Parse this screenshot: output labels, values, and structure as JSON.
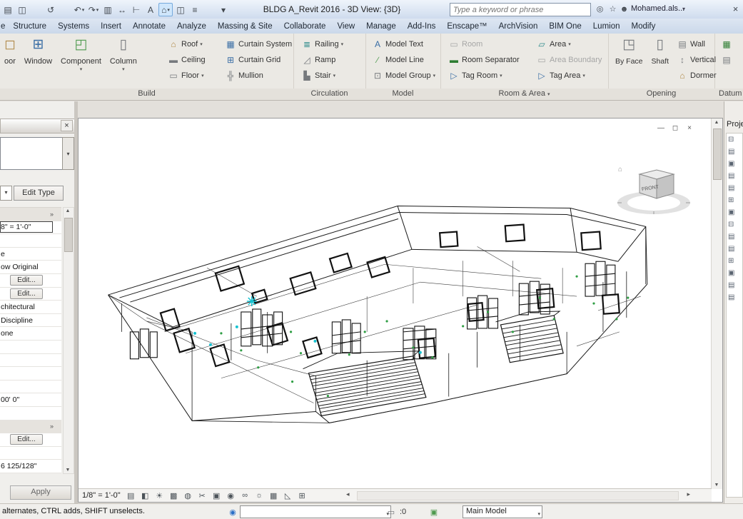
{
  "colors": {
    "titlebar_blue": "#d6e2f2",
    "ribbon_bg": "#ebe9e4",
    "canvas_bg": "#ffffff",
    "selection_cyan": "#17c3d2",
    "marker_green": "#2f9e44",
    "disabled_gray": "#a6a6a6"
  },
  "titlebar": {
    "title": "BLDG A_Revit 2016 - 3D View: {3D}",
    "search_placeholder": "Type a keyword or phrase",
    "username": "Mohamed.als...",
    "qat": [
      {
        "name": "open-icon",
        "glyph": "▤"
      },
      {
        "name": "save-icon",
        "glyph": "◫"
      },
      {
        "name": "qat-separator",
        "glyph": "",
        "sep": true
      },
      {
        "name": "sync-icon",
        "glyph": "↺"
      },
      {
        "name": "qat-separator",
        "glyph": "",
        "sep": true
      },
      {
        "name": "undo-icon",
        "glyph": "↶",
        "dd": true
      },
      {
        "name": "redo-icon",
        "glyph": "↷",
        "dd": true
      },
      {
        "name": "print-icon",
        "glyph": "▥"
      },
      {
        "name": "measure-icon",
        "glyph": "↔"
      },
      {
        "name": "aligned-dimension-icon",
        "glyph": "⊢"
      },
      {
        "name": "text-icon",
        "glyph": "A"
      },
      {
        "name": "default-3d-view-icon",
        "glyph": "⌂",
        "active": true,
        "dd": true
      },
      {
        "name": "section-icon",
        "glyph": "◫"
      },
      {
        "name": "thin-lines-icon",
        "glyph": "≡"
      },
      {
        "name": "qat-separator",
        "glyph": "",
        "sep": true
      },
      {
        "name": "qat-customize-icon",
        "glyph": "▾"
      }
    ],
    "search_go_glyph": "◎",
    "star_glyph": "☆",
    "signin_glyph": "☻",
    "exchange_glyph": "×",
    "user_dd_glyph": "▾"
  },
  "tabs": [
    "e",
    "Structure",
    "Systems",
    "Insert",
    "Annotate",
    "Analyze",
    "Massing & Site",
    "Collaborate",
    "View",
    "Manage",
    "Add-Ins",
    "Enscape™",
    "ArchVision",
    "BIM One",
    "Lumion",
    "Modify"
  ],
  "ribbon": {
    "build": {
      "title": "Build",
      "big": [
        {
          "name": "door-button",
          "icon_name": "door-icon",
          "icon_class": "c-tan",
          "glyph": "◻",
          "label": "oor"
        },
        {
          "name": "window-button",
          "icon_name": "window-icon",
          "icon_class": "c-blue",
          "glyph": "⊞",
          "label": "Window"
        },
        {
          "name": "component-button",
          "icon_name": "component-icon",
          "icon_class": "c-green",
          "glyph": "◰",
          "label": "Component",
          "dropdown": true
        },
        {
          "name": "column-button",
          "icon_name": "column-icon",
          "icon_class": "c-gray",
          "glyph": "▯",
          "label": "Column",
          "dropdown": true
        }
      ],
      "col1": [
        {
          "name": "roof-button",
          "icon_name": "roof-icon",
          "icon_class": "c-tan",
          "glyph": "⌂",
          "label": "Roof",
          "dropdown": true
        },
        {
          "name": "ceiling-button",
          "icon_name": "ceiling-icon",
          "icon_class": "c-gray",
          "glyph": "▬",
          "label": "Ceiling"
        },
        {
          "name": "floor-button",
          "icon_name": "floor-icon",
          "icon_class": "c-gray",
          "glyph": "▭",
          "label": "Floor",
          "dropdown": true
        }
      ],
      "col2": [
        {
          "name": "curtain-system-button",
          "icon_name": "curtain-system-icon",
          "icon_class": "c-blue",
          "glyph": "▦",
          "label": "Curtain System"
        },
        {
          "name": "curtain-grid-button",
          "icon_name": "curtain-grid-icon",
          "icon_class": "c-blue",
          "glyph": "⊞",
          "label": "Curtain Grid"
        },
        {
          "name": "mullion-button",
          "icon_name": "mullion-icon",
          "icon_class": "c-gray",
          "glyph": "╬",
          "label": "Mullion"
        }
      ]
    },
    "circulation": {
      "title": "Circulation",
      "col1": [
        {
          "name": "railing-button",
          "icon_name": "railing-icon",
          "icon_class": "c-teal",
          "glyph": "≣",
          "label": "Railing",
          "dropdown": true
        },
        {
          "name": "ramp-button",
          "icon_name": "ramp-icon",
          "icon_class": "c-gray",
          "glyph": "◿",
          "label": "Ramp"
        },
        {
          "name": "stair-button",
          "icon_name": "stair-icon",
          "icon_class": "c-gray",
          "glyph": "▙",
          "label": "Stair",
          "dropdown": true
        }
      ]
    },
    "model": {
      "title": "Model",
      "col1": [
        {
          "name": "model-text-button",
          "icon_name": "model-text-icon",
          "icon_class": "c-blue",
          "glyph": "A",
          "label": "Model Text"
        },
        {
          "name": "model-line-button",
          "icon_name": "model-line-icon",
          "icon_class": "c-green",
          "glyph": "∕",
          "label": "Model Line"
        },
        {
          "name": "model-group-button",
          "icon_name": "model-group-icon",
          "icon_class": "c-gray",
          "glyph": "⊡",
          "label": "Model Group",
          "dropdown": true
        }
      ]
    },
    "room_area": {
      "title": "Room & Area",
      "col1": [
        {
          "name": "room-button",
          "icon_name": "room-icon",
          "icon_class": "c-gray",
          "glyph": "▭",
          "label": "Room",
          "disabled": true
        },
        {
          "name": "room-separator-button",
          "icon_name": "room-separator-icon",
          "icon_class": "c-dkgreen",
          "glyph": "▬",
          "label": "Room Separator"
        },
        {
          "name": "tag-room-button",
          "icon_name": "tag-room-icon",
          "icon_class": "c-blue",
          "glyph": "▷",
          "label": "Tag Room",
          "dropdown": true
        }
      ],
      "col2": [
        {
          "name": "area-button",
          "icon_name": "area-icon",
          "icon_class": "c-teal",
          "glyph": "▱",
          "label": "Area",
          "dropdown": true
        },
        {
          "name": "area-boundary-button",
          "icon_name": "area-boundary-icon",
          "icon_class": "c-gray",
          "glyph": "▭",
          "label": "Area Boundary",
          "disabled": true
        },
        {
          "name": "tag-area-button",
          "icon_name": "tag-area-icon",
          "icon_class": "c-blue",
          "glyph": "▷",
          "label": "Tag Area",
          "dropdown": true
        }
      ]
    },
    "opening": {
      "title": "Opening",
      "big": [
        {
          "name": "opening-by-face-button",
          "icon_name": "by-face-icon",
          "icon_class": "c-gray",
          "glyph": "◳",
          "label": "By Face"
        },
        {
          "name": "shaft-button",
          "icon_name": "shaft-icon",
          "icon_class": "c-gray",
          "glyph": "▯",
          "label": "Shaft"
        }
      ],
      "col1": [
        {
          "name": "wall-opening-button",
          "icon_name": "wall-opening-icon",
          "icon_class": "c-gray",
          "glyph": "▤",
          "label": "Wall"
        },
        {
          "name": "vertical-opening-button",
          "icon_name": "vertical-opening-icon",
          "icon_class": "c-gray",
          "glyph": "↕",
          "label": "Vertical"
        },
        {
          "name": "dormer-button",
          "icon_name": "dormer-icon",
          "icon_class": "c-tan",
          "glyph": "⌂",
          "label": "Dormer"
        }
      ]
    },
    "datum": {
      "title": "Datum",
      "col1": [
        {
          "name": "level-button",
          "icon_name": "level-icon",
          "icon_class": "c-dkgreen",
          "glyph": "▦",
          "label": ""
        },
        {
          "name": "grid-button",
          "icon_name": "grid-icon",
          "icon_class": "c-gray",
          "glyph": "▤",
          "label": ""
        }
      ]
    }
  },
  "properties": {
    "close_glyph": "×",
    "type_dd_glyph": "▾",
    "mini_dd_glyph": "▾",
    "edit_type_label": "Edit Type",
    "apply_label": "Apply",
    "rows": [
      {
        "kind": "header",
        "text": "",
        "chev": "»"
      },
      {
        "kind": "input",
        "text": "8\" = 1'-0\""
      },
      {
        "kind": "value",
        "text": ""
      },
      {
        "kind": "value",
        "text": "e"
      },
      {
        "kind": "value",
        "text": "ow Original"
      },
      {
        "kind": "button",
        "text": "Edit..."
      },
      {
        "kind": "button",
        "text": "Edit..."
      },
      {
        "kind": "value",
        "text": "chitectural"
      },
      {
        "kind": "value",
        "text": "Discipline"
      },
      {
        "kind": "value",
        "text": "one"
      },
      {
        "kind": "value",
        "text": ""
      },
      {
        "kind": "value",
        "text": ""
      },
      {
        "kind": "value",
        "text": ""
      },
      {
        "kind": "value",
        "text": ""
      },
      {
        "kind": "value",
        "text": "00' 0\""
      },
      {
        "kind": "value",
        "text": ""
      },
      {
        "kind": "header",
        "text": "",
        "chev": "»"
      },
      {
        "kind": "button",
        "text": "Edit..."
      },
      {
        "kind": "value",
        "text": ""
      },
      {
        "kind": "value",
        "text": "6 125/128\""
      }
    ]
  },
  "viewcube": {
    "front_label": "FRONT",
    "home_glyph": "⌂"
  },
  "view_window": {
    "controls": [
      {
        "name": "minimize-view-icon",
        "glyph": "—"
      },
      {
        "name": "restore-view-icon",
        "glyph": "◻"
      },
      {
        "name": "close-view-icon",
        "glyph": "×"
      }
    ]
  },
  "viewbar": {
    "scale": "1/8\" = 1'-0\"",
    "icons": [
      {
        "name": "detail-level-icon",
        "glyph": "▤"
      },
      {
        "name": "visual-style-icon",
        "glyph": "◧"
      },
      {
        "name": "sun-path-icon",
        "glyph": "☀"
      },
      {
        "name": "shadows-icon",
        "glyph": "▩"
      },
      {
        "name": "render-icon",
        "glyph": "◍"
      },
      {
        "name": "crop-view-icon",
        "glyph": "✂"
      },
      {
        "name": "show-crop-icon",
        "glyph": "▣"
      },
      {
        "name": "lock-3d-view-icon",
        "glyph": "◉"
      },
      {
        "name": "temporary-hide-isolate-icon",
        "glyph": "∞"
      },
      {
        "name": "reveal-hidden-icon",
        "glyph": "☼"
      },
      {
        "name": "temporary-view-properties-icon",
        "glyph": "▦"
      },
      {
        "name": "analytical-model-icon",
        "glyph": "◺"
      },
      {
        "name": "displacement-sets-icon",
        "glyph": "⊞"
      }
    ],
    "hsb_left_glyph": "◂",
    "hsb_right_glyph": "▸"
  },
  "project_browser": {
    "title": "Proje",
    "nodes": [
      "⊟",
      "▤",
      "▣",
      "▤",
      "▤",
      "⊞",
      "▣",
      "⊟",
      "▤",
      "▤",
      "⊞",
      "▣",
      "▤",
      "▤"
    ]
  },
  "statusbar": {
    "hint": "alternates, CTRL adds, SHIFT unselects.",
    "worksets_glyph": "◉",
    "workset_value": "",
    "editable_glyph": "▭",
    "counter": ":0",
    "options_glyph": "▣",
    "design_option": "Main Model",
    "dd_glyph": "▾"
  },
  "scrollbar_glyphs": {
    "up": "▲",
    "down": "▼"
  }
}
